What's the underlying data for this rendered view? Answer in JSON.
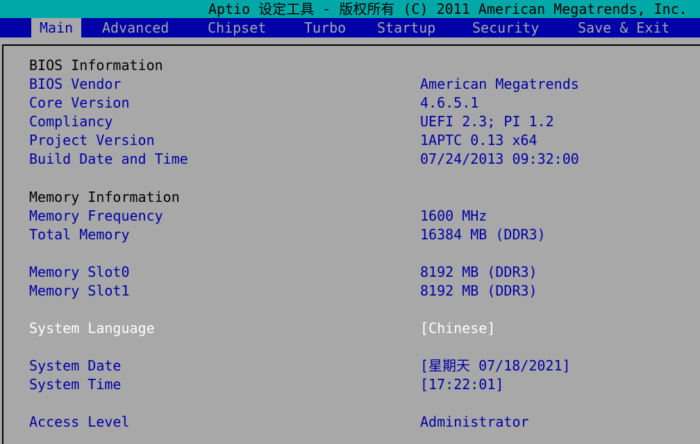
{
  "title": "Aptio 设定工具 - 版权所有 (C) 2011 American Megatrends, Inc.",
  "tabs": [
    "Main",
    "Advanced",
    "Chipset",
    "Turbo",
    "Startup",
    "Security",
    "Save & Exit"
  ],
  "bios_info": {
    "heading": "BIOS Information",
    "vendor_label": "BIOS Vendor",
    "vendor_value": "American Megatrends",
    "core_label": "Core Version",
    "core_value": "4.6.5.1",
    "compliancy_label": "Compliancy",
    "compliancy_value": "UEFI 2.3; PI 1.2",
    "project_label": "Project Version",
    "project_value": "1APTC 0.13 x64",
    "build_label": "Build Date and Time",
    "build_value": "07/24/2013 09:32:00"
  },
  "memory_info": {
    "heading": "Memory Information",
    "freq_label": "Memory Frequency",
    "freq_value": "1600 MHz",
    "total_label": "Total Memory",
    "total_value": "16384 MB (DDR3)",
    "slot0_label": "Memory Slot0",
    "slot0_value": "8192 MB (DDR3)",
    "slot1_label": "Memory Slot1",
    "slot1_value": "8192 MB (DDR3)"
  },
  "language": {
    "label": "System Language",
    "value": "[Chinese]"
  },
  "datetime": {
    "date_label": "System Date",
    "date_value": "[星期天 07/18/2021]",
    "time_label": "System Time",
    "time_value": "[17:22:01]"
  },
  "access": {
    "label": "Access Level",
    "value": "Administrator"
  },
  "colors": {
    "background": "#a8a8a8",
    "title_bar": "#00a8a8",
    "menu_bar": "#0000a8",
    "label_text": "#0000a8",
    "selected_text": "#ffffff"
  }
}
